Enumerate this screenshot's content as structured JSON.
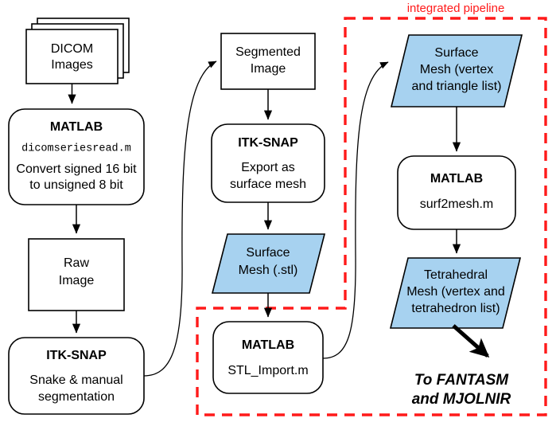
{
  "diagram": {
    "title_label": "integrated pipeline",
    "accent_color": "#ff1a1a",
    "data_fill_color": "#a7d2f0",
    "node_fill_color": "#ffffff",
    "stroke_color": "#000000"
  },
  "nodes": {
    "dicom_images": {
      "line1": "DICOM",
      "line2": "Images"
    },
    "matlab_dicomread": {
      "title": "MATLAB",
      "script": "dicomseriesread.m",
      "desc_line1": "Convert signed 16 bit",
      "desc_line2": "to unsigned 8 bit"
    },
    "raw_image": {
      "line1": "Raw",
      "line2": "Image"
    },
    "itksnap_segment": {
      "title": "ITK-SNAP",
      "desc_line1": "Snake & manual",
      "desc_line2": "segmentation"
    },
    "segmented_image": {
      "line1": "Segmented",
      "line2": "Image"
    },
    "itksnap_export": {
      "title": "ITK-SNAP",
      "desc_line1": "Export as",
      "desc_line2": "surface mesh"
    },
    "surface_mesh_stl": {
      "line1": "Surface",
      "line2": "Mesh (.stl)"
    },
    "matlab_stl_import": {
      "title": "MATLAB",
      "script": "STL_Import.m"
    },
    "surface_mesh_vertex": {
      "line1": "Surface",
      "line2": "Mesh (vertex",
      "line3": "and triangle list)"
    },
    "matlab_surf2mesh": {
      "title": "MATLAB",
      "script": "surf2mesh.m"
    },
    "tetrahedral_mesh": {
      "line1": "Tetrahedral",
      "line2": "Mesh (vertex and",
      "line3": "tetrahedron list)"
    },
    "output_target": {
      "line1": "To FANTASM",
      "line2": "and MJOLNIR"
    }
  }
}
